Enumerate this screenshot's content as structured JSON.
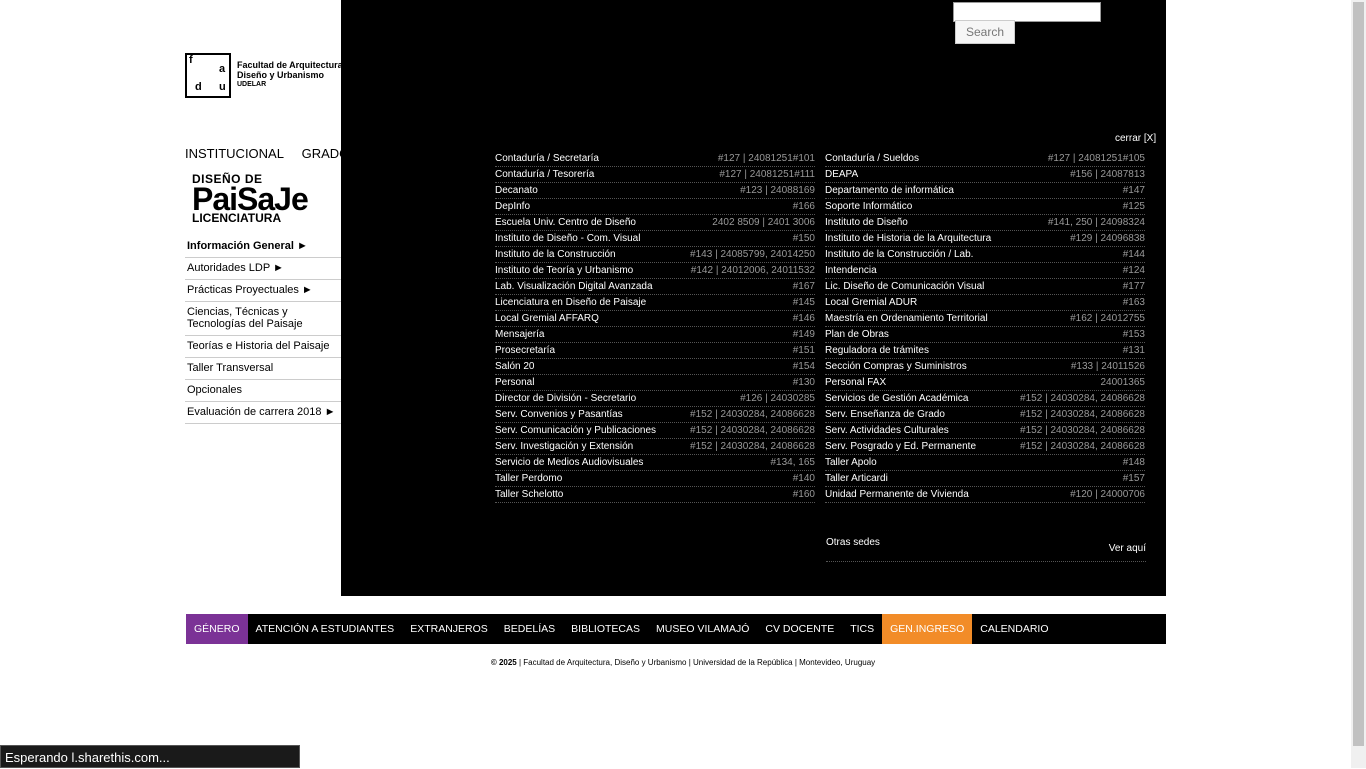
{
  "logo": {
    "line1": "Facultad de Arquitectura",
    "line2": "Diseño y Urbanismo",
    "line3": "UDELAR",
    "letters": [
      "f",
      "a",
      "d",
      "u"
    ]
  },
  "topnav": [
    "INSTITUCIONAL",
    "GRADO"
  ],
  "plogo": {
    "a": "DISEÑO DE",
    "b": "PaiSaJe",
    "c": "LICENCIATURA"
  },
  "side": [
    "Información General ►",
    "Autoridades LDP ►",
    "Prácticas Proyectuales ►",
    "Ciencias, Técnicas y Tecnologías del Paisaje",
    "Teorías e Historia del Paisaje",
    "Taller Transversal",
    "Opcionales",
    "Evaluación de carrera 2018 ►"
  ],
  "search": {
    "button": "Search",
    "value": ""
  },
  "cerrar": "cerrar [X]",
  "left": [
    [
      "Contaduría / Secretaría",
      "#127 | 24081251#101"
    ],
    [
      "Contaduría / Tesorería",
      "#127 | 24081251#111"
    ],
    [
      "Decanato",
      "#123 | 24088169"
    ],
    [
      "DepInfo",
      "#166"
    ],
    [
      "Escuela Univ. Centro de Diseño",
      "2402 8509 | 2401 3006"
    ],
    [
      "Instituto de Diseño - Com. Visual",
      "#150"
    ],
    [
      "Instituto de la Construcción",
      "#143 | 24085799, 24014250"
    ],
    [
      "Instituto de Teoría y Urbanismo",
      "#142 | 24012006, 24011532"
    ],
    [
      "Lab. Visualización Digital Avanzada",
      "#167"
    ],
    [
      "Licenciatura en Diseño de Paisaje",
      "#145"
    ],
    [
      "Local Gremial AFFARQ",
      "#146"
    ],
    [
      "Mensajería",
      "#149"
    ],
    [
      "Prosecretaría",
      "#151"
    ],
    [
      "Salón 20",
      "#154"
    ],
    [
      "Personal",
      "#130"
    ],
    [
      "Director de División - Secretario",
      "#126 | 24030285"
    ],
    [
      "Serv. Convenios y Pasantías",
      "#152 | 24030284, 24086628"
    ],
    [
      "Serv. Comunicación y Publicaciones",
      "#152 | 24030284, 24086628"
    ],
    [
      "Serv. Investigación y Extensión",
      "#152 | 24030284, 24086628"
    ],
    [
      "Servicio de Medios Audiovisuales",
      "#134, 165"
    ],
    [
      "Taller Perdomo",
      "#140"
    ],
    [
      "Taller Schelotto",
      "#160"
    ]
  ],
  "right": [
    [
      "Contaduría / Sueldos",
      "#127 | 24081251#105"
    ],
    [
      "DEAPA",
      "#156 | 24087813"
    ],
    [
      "Departamento de informática",
      "#147"
    ],
    [
      "Soporte Informático",
      "#125"
    ],
    [
      "Instituto de Diseño",
      "#141, 250 | 24098324"
    ],
    [
      "Instituto de Historia de la Arquitectura",
      "#129 | 24096838"
    ],
    [
      "Instituto de la Construcción / Lab.",
      "#144"
    ],
    [
      "Intendencia",
      "#124"
    ],
    [
      "Lic. Diseño de Comunicación Visual",
      "#177"
    ],
    [
      "Local Gremial ADUR",
      "#163"
    ],
    [
      "Maestría en Ordenamiento Territorial",
      "#162 | 24012755"
    ],
    [
      "Plan de Obras",
      "#153"
    ],
    [
      "Reguladora de trámites",
      "#131"
    ],
    [
      "Sección Compras y Suministros",
      "#133 | 24011526"
    ],
    [
      "Personal FAX",
      "24001365"
    ],
    [
      "Servicios de Gestión Académica",
      "#152 | 24030284, 24086628"
    ],
    [
      "Serv. Enseñanza de Grado",
      "#152 | 24030284, 24086628"
    ],
    [
      "Serv. Actividades Culturales",
      "#152 | 24030284, 24086628"
    ],
    [
      "Serv. Posgrado y Ed. Permanente",
      "#152 | 24030284, 24086628"
    ],
    [
      "Taller Apolo",
      "#148"
    ],
    [
      "Taller Articardi",
      "#157"
    ],
    [
      "Unidad Permanente de Vivienda",
      "#120 | 24000706"
    ]
  ],
  "otras": {
    "label": "Otras sedes",
    "link": "Ver aquí"
  },
  "bottomnav": [
    "GÉNERO",
    "ATENCIÓN A ESTUDIANTES",
    "EXTRANJEROS",
    "BEDELÍAS",
    "BIBLIOTECAS",
    "MUSEO VILAMAJÓ",
    "CV DOCENTE",
    "TICS",
    "GEN.INGRESO",
    "CALENDARIO"
  ],
  "footer": {
    "bold": "© 2025",
    "rest": " | Facultad de Arquitectura, Diseño y Urbanismo | Universidad de la República | Montevideo, Uruguay"
  },
  "status": "Esperando l.sharethis.com..."
}
